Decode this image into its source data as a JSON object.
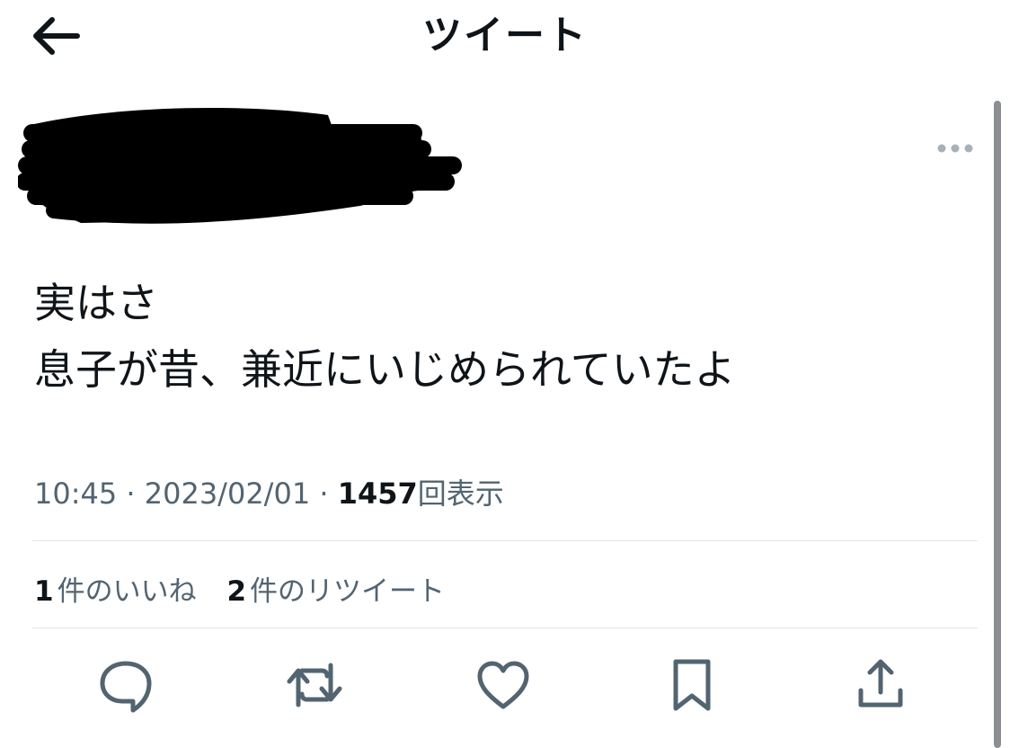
{
  "header": {
    "title": "ツイート",
    "back_icon": "arrow-left-icon"
  },
  "author": {
    "redacted": true,
    "avatar_color": "#5fa83c",
    "more_icon": "more-horizontal-icon"
  },
  "tweet": {
    "lines": [
      "実はさ",
      "息子が昔、兼近にいじめられていたよ"
    ]
  },
  "meta": {
    "time": "10:45",
    "separator": "·",
    "date": "2023/02/01",
    "views_count": "1457",
    "views_label": "回表示"
  },
  "stats": {
    "likes_count": "1",
    "likes_label": "件のいいね",
    "retweets_count": "2",
    "retweets_label": "件のリツイート"
  },
  "actions": [
    {
      "name": "reply",
      "icon": "comment-bubble-icon"
    },
    {
      "name": "retweet",
      "icon": "retweet-icon"
    },
    {
      "name": "like",
      "icon": "heart-icon"
    },
    {
      "name": "bookmark",
      "icon": "bookmark-icon"
    },
    {
      "name": "share",
      "icon": "share-upload-icon"
    }
  ],
  "colors": {
    "text_primary": "#0f1419",
    "text_secondary": "#536471",
    "icon_color": "#536471",
    "divider": "#e1e6ea",
    "redaction": "#000000"
  }
}
